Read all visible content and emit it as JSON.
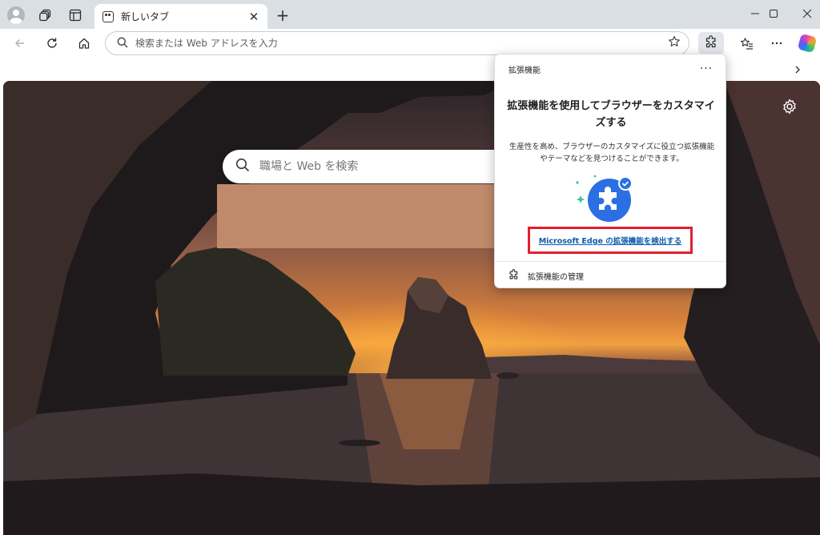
{
  "tab": {
    "title": "新しいタブ"
  },
  "address_bar": {
    "placeholder": "検索または Web アドレスを入力"
  },
  "ntp": {
    "search_placeholder": "職場と Web を検索"
  },
  "extensions_popup": {
    "header_title": "拡張機能",
    "heading": "拡張機能を使用してブラウザーをカスタマイズする",
    "description": "生産性を高め、ブラウザーのカスタマイズに役立つ拡張機能やテーマなどを見つけることができます。",
    "discover_link": "Microsoft Edge の拡張機能を検出する",
    "manage_label": "拡張機能の管理",
    "more_label": "···"
  },
  "icons": {
    "titlebar": [
      "profile-avatar",
      "workspaces-icon",
      "tab-actions-icon"
    ],
    "tab": [
      "new-tab-page-icon",
      "close-icon"
    ],
    "window": [
      "minimize-icon",
      "maximize-icon",
      "close-icon"
    ],
    "toolbar": [
      "back-icon",
      "refresh-icon",
      "home-icon",
      "search-icon",
      "favorite-star-icon",
      "extensions-icon",
      "favorites-icon",
      "more-icon",
      "copilot-icon"
    ]
  },
  "colors": {
    "titlebar": "#dadfe4",
    "highlight_box": "#e21f2e",
    "link": "#0b5cad",
    "extensions_button_active": "#e3e6ea"
  }
}
